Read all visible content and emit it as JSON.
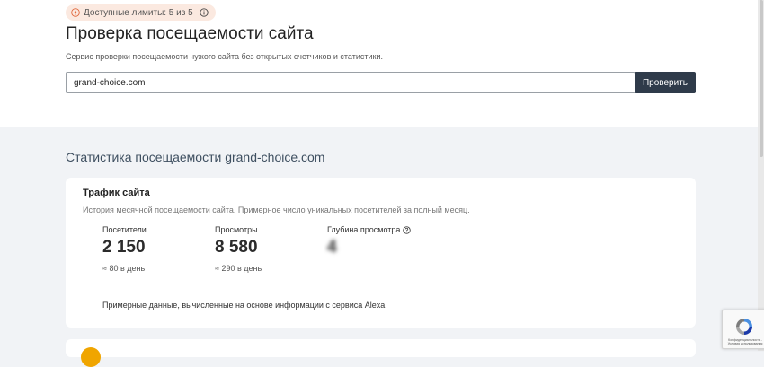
{
  "header": {
    "limits_text": "Доступные лимиты: 5 из 5",
    "title": "Проверка посещаемости сайта",
    "subtitle": "Сервис проверки посещаемости чужого сайта без открытых счетчиков и статистики."
  },
  "search": {
    "value": "grand-choice.com",
    "button_label": "Проверить"
  },
  "stats": {
    "heading": "Статистика посещаемости grand-choice.com",
    "card": {
      "title": "Трафик сайта",
      "description": "История месячной посещаемости сайта. Примерное число уникальных посетителей за полный месяц.",
      "metrics": [
        {
          "label": "Посетители",
          "value": "2 150",
          "per_day": "≈ 80 в день"
        },
        {
          "label": "Просмотры",
          "value": "8 580",
          "per_day": "≈ 290 в день"
        },
        {
          "label": "Глубина просмотра",
          "value": "4"
        }
      ],
      "footnote": "Примерные данные, вычисленные на основе информации с сервиса Alexa"
    }
  },
  "recaptcha": {
    "text": "Конфиденциальность - Условия использования"
  },
  "colors": {
    "accent_button": "#2f3b4a",
    "limits_badge": "#fbe9e0",
    "page_bg": "#f1f3f6"
  },
  "icons": [
    "lightning-icon",
    "info-icon",
    "question-icon",
    "recaptcha-icon"
  ]
}
